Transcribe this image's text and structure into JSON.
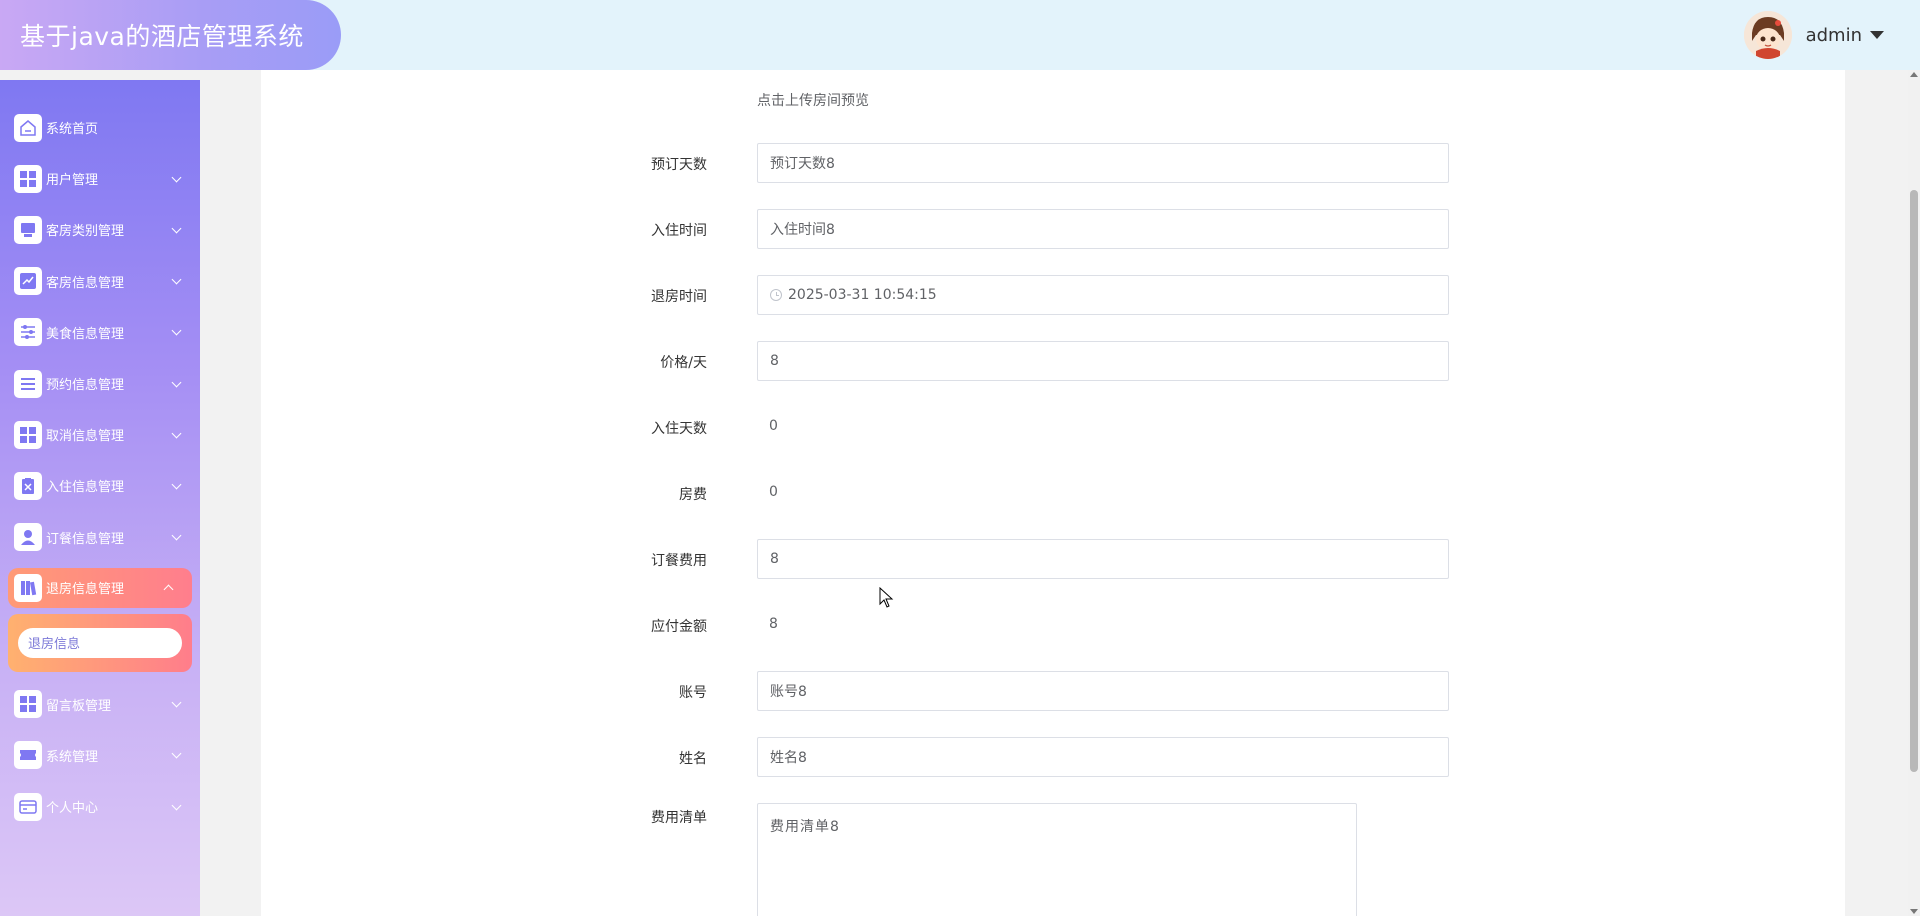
{
  "header": {
    "title": "基于java的酒店管理系统",
    "user_name": "admin"
  },
  "sidebar": {
    "items": [
      {
        "label": "系统首页",
        "icon": "home-icon"
      },
      {
        "label": "用户管理",
        "icon": "grid-icon"
      },
      {
        "label": "客房类别管理",
        "icon": "monitor-icon"
      },
      {
        "label": "客房信息管理",
        "icon": "chart-icon"
      },
      {
        "label": "美食信息管理",
        "icon": "sliders-icon"
      },
      {
        "label": "预约信息管理",
        "icon": "list-icon"
      },
      {
        "label": "取消信息管理",
        "icon": "grid-icon"
      },
      {
        "label": "入住信息管理",
        "icon": "clipboard-icon"
      },
      {
        "label": "订餐信息管理",
        "icon": "user-icon"
      },
      {
        "label": "退房信息管理",
        "icon": "book-icon"
      },
      {
        "label": "留言板管理",
        "icon": "grid-icon"
      },
      {
        "label": "系统管理",
        "icon": "ticket-icon"
      },
      {
        "label": "个人中心",
        "icon": "card-icon"
      }
    ],
    "active_submenu_item": "退房信息"
  },
  "form": {
    "upload_hint": "点击上传房间预览",
    "fields": {
      "booking_days": {
        "label": "预订天数",
        "value": "预订天数8"
      },
      "checkin_time": {
        "label": "入住时间",
        "value": "入住时间8"
      },
      "checkout_time": {
        "label": "退房时间",
        "value": "2025-03-31 10:54:15"
      },
      "price_per_day": {
        "label": "价格/天",
        "value": "8"
      },
      "stay_days": {
        "label": "入住天数",
        "value": "0"
      },
      "room_fee": {
        "label": "房费",
        "value": "0"
      },
      "meal_fee": {
        "label": "订餐费用",
        "value": "8"
      },
      "amount_due": {
        "label": "应付金额",
        "value": "8"
      },
      "account": {
        "label": "账号",
        "value": "账号8"
      },
      "name": {
        "label": "姓名",
        "value": "姓名8"
      },
      "fee_list": {
        "label": "费用清单",
        "value": "费用清单8"
      }
    }
  },
  "colors": {
    "header_bg": "#e3f3fb",
    "brand_gradient_start": "#c9a8f4",
    "brand_gradient_end": "#9a9cf7",
    "sidebar_top": "#7f78f2",
    "sidebar_bottom": "#dcc7f6",
    "active_gradient_start": "#ff9a76",
    "active_gradient_end": "#ff7e8d"
  }
}
